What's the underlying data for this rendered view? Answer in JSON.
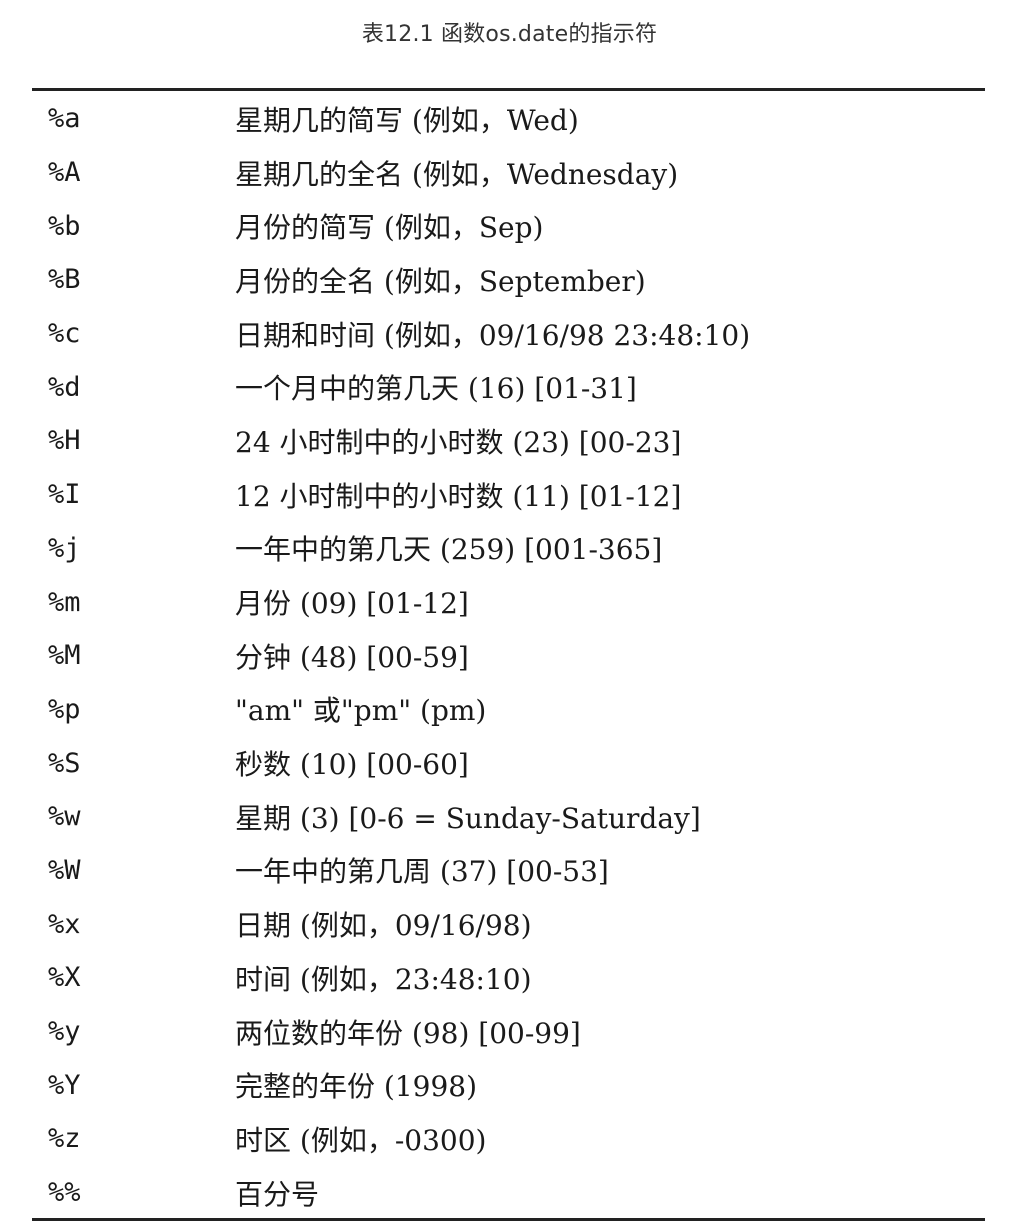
{
  "caption": "表12.1 函数os.date的指示符",
  "rows": [
    {
      "code": "%a",
      "desc": "星期几的简写 (例如，Wed)"
    },
    {
      "code": "%A",
      "desc": "星期几的全名 (例如，Wednesday)"
    },
    {
      "code": "%b",
      "desc": "月份的简写 (例如，Sep)"
    },
    {
      "code": "%B",
      "desc": "月份的全名 (例如，September)"
    },
    {
      "code": "%c",
      "desc": "日期和时间 (例如，09/16/98 23:48:10)"
    },
    {
      "code": "%d",
      "desc": "一个月中的第几天 (16) [01-31]"
    },
    {
      "code": "%H",
      "desc": "24 小时制中的小时数 (23) [00-23]"
    },
    {
      "code": "%I",
      "desc": "12 小时制中的小时数 (11) [01-12]"
    },
    {
      "code": "%j",
      "desc": "一年中的第几天 (259) [001-365]"
    },
    {
      "code": "%m",
      "desc": "月份 (09) [01-12]"
    },
    {
      "code": "%M",
      "desc": "分钟 (48) [00-59]"
    },
    {
      "code": "%p",
      "desc": "\"am\" 或\"pm\" (pm)"
    },
    {
      "code": "%S",
      "desc": "秒数 (10) [00-60]"
    },
    {
      "code": "%w",
      "desc": "星期 (3) [0-6 = Sunday-Saturday]"
    },
    {
      "code": "%W",
      "desc": "一年中的第几周 (37) [00-53]"
    },
    {
      "code": "%x",
      "desc": "日期 (例如，09/16/98)"
    },
    {
      "code": "%X",
      "desc": "时间 (例如，23:48:10)"
    },
    {
      "code": "%y",
      "desc": "两位数的年份 (98) [00-99]"
    },
    {
      "code": "%Y",
      "desc": "完整的年份 (1998)"
    },
    {
      "code": "%z",
      "desc": "时区 (例如，-0300)"
    },
    {
      "code": "%%",
      "desc": "百分号"
    }
  ]
}
